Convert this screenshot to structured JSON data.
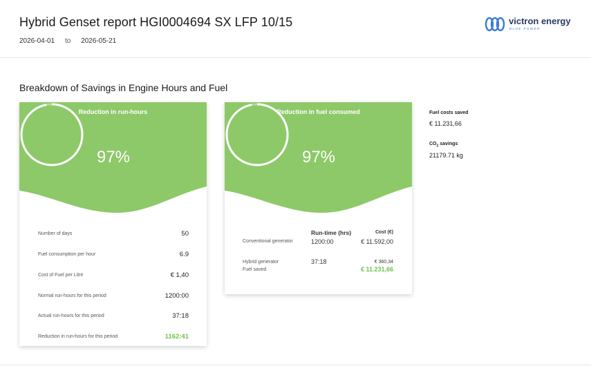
{
  "report": {
    "title": "Hybrid Genset report HGI0004694 SX LFP 10/15",
    "date_from": "2026-04-01",
    "date_to_label": "to",
    "date_to": "2026-05-21"
  },
  "logo": {
    "text": "victron energy",
    "subtext": "BLUE POWER"
  },
  "section_title": "Breakdown of Savings in Engine Hours and Fuel",
  "colors": {
    "accent_green": "#8dc968",
    "value_green": "#6cc34a",
    "gauge_ring": "#ffffff",
    "logo_blue": "#3a7bd5"
  },
  "runhours_card": {
    "heading": "Reduction in run-hours",
    "gauge_value": "97%",
    "gauge_fraction": 0.97,
    "rows": [
      {
        "label": "Number of days",
        "value": "50"
      },
      {
        "label": "Fuel consumption per hour",
        "value": "6.9"
      },
      {
        "label": "Cost of Fuel per Litre",
        "value": "€ 1,40"
      },
      {
        "label": "Normal run-hours for this period",
        "value": "1200:00"
      },
      {
        "label": "Actual run-hours for this period",
        "value": "37:18"
      },
      {
        "label": "Reduction in run-hours for this period",
        "value": "1162:41"
      }
    ]
  },
  "fuel_card": {
    "heading": "Reduction in fuel consumed",
    "gauge_value": "97%",
    "gauge_fraction": 0.97,
    "col_runtime": "Run-time (hrs)",
    "col_cost": "Cost (€)",
    "conventional_label": "Conventional generator",
    "conventional_runtime": "1200:00",
    "conventional_cost": "€ 11.592,00",
    "hybrid_label": "Hybrid generator",
    "hybrid_runtime": "37:18",
    "hybrid_cost": "€ 360,34",
    "fuel_saved_label": "Fuel saved",
    "fuel_saved_value": "€ 11.231,66"
  },
  "side_stats": {
    "fuel_costs_label": "Fuel costs saved",
    "fuel_costs_value": "€ 11.231,66",
    "co2_label_prefix": "CO",
    "co2_label_sub": "2",
    "co2_label_suffix": " savings",
    "co2_value": "21179.71 kg"
  }
}
